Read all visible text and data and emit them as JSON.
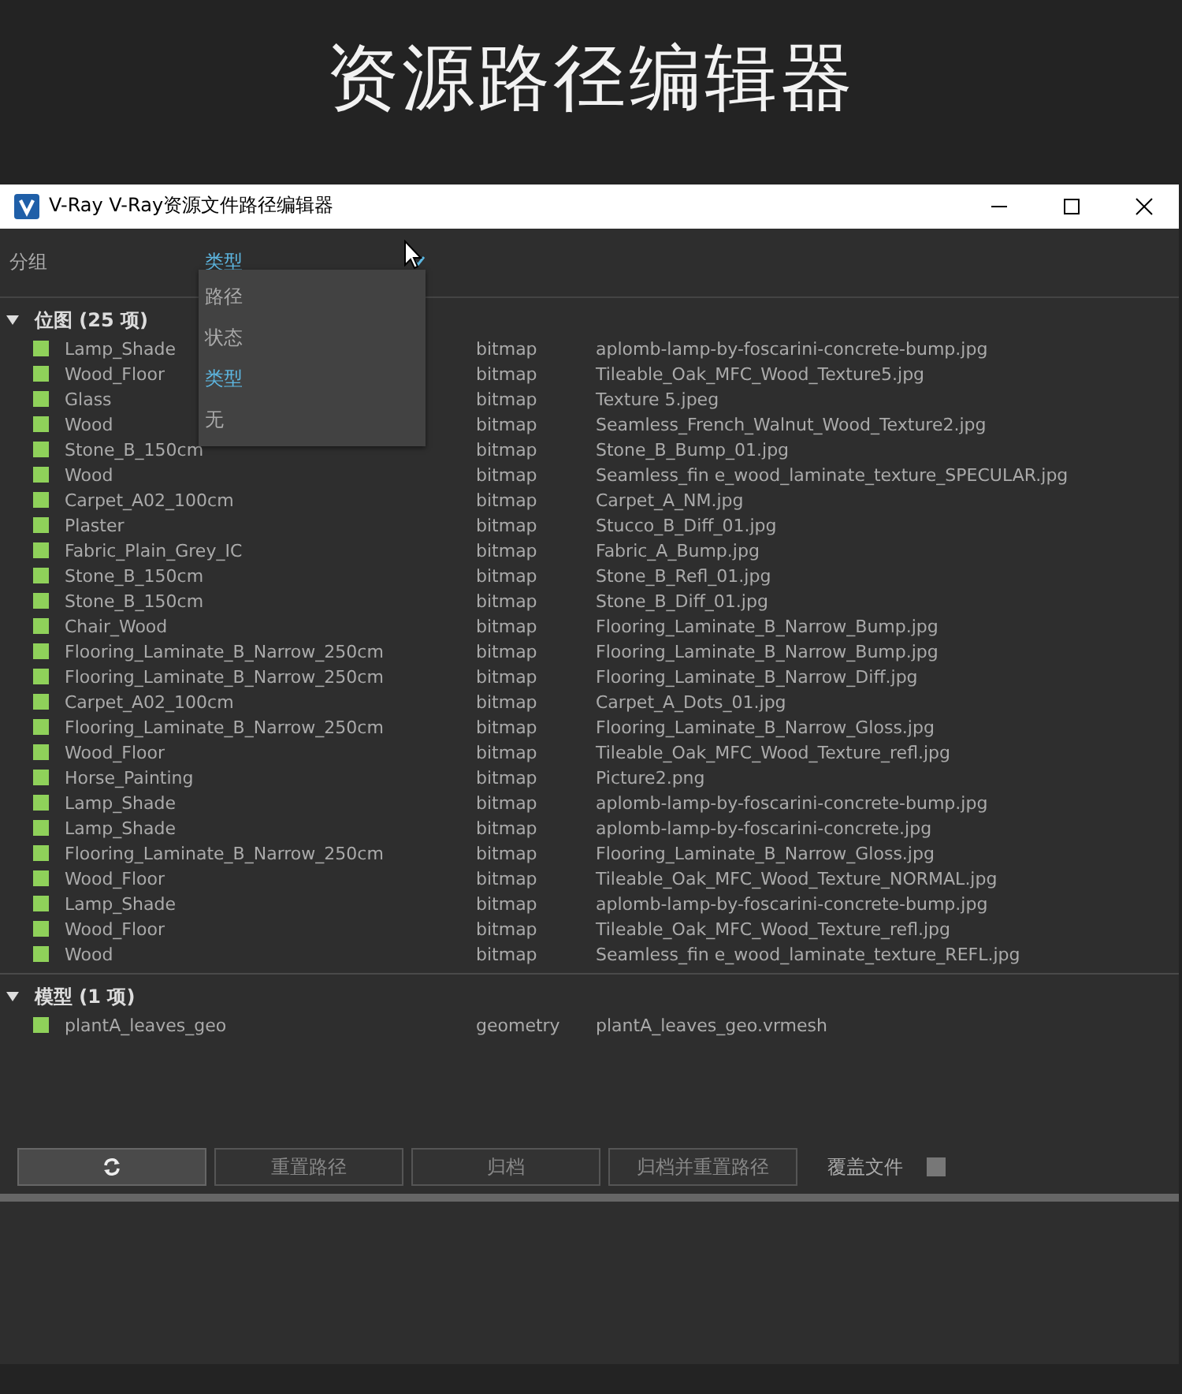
{
  "banner": {
    "title": "资源路径编辑器"
  },
  "window": {
    "title": "V-Ray V-Ray资源文件路径编辑器"
  },
  "group_by": {
    "label": "分组",
    "value": "类型",
    "expanded": true,
    "options": [
      {
        "label": "路径",
        "selected": false
      },
      {
        "label": "状态",
        "selected": false
      },
      {
        "label": "类型",
        "selected": true
      },
      {
        "label": "无",
        "selected": false
      }
    ]
  },
  "groups": [
    {
      "title": "位图 (25 项)",
      "expanded": true,
      "items": [
        {
          "name": "Lamp_Shade",
          "type": "bitmap",
          "path": "aplomb-lamp-by-foscarini-concrete-bump.jpg"
        },
        {
          "name": "Wood_Floor",
          "type": "bitmap",
          "path": "Tileable_Oak_MFC_Wood_Texture5.jpg"
        },
        {
          "name": "Glass",
          "type": "bitmap",
          "path": "Texture 5.jpeg"
        },
        {
          "name": "Wood",
          "type": "bitmap",
          "path": "Seamless_French_Walnut_Wood_Texture2.jpg"
        },
        {
          "name": "Stone_B_150cm",
          "type": "bitmap",
          "path": "Stone_B_Bump_01.jpg"
        },
        {
          "name": "Wood",
          "type": "bitmap",
          "path": "Seamless_fin e_wood_laminate_texture_SPECULAR.jpg"
        },
        {
          "name": "Carpet_A02_100cm",
          "type": "bitmap",
          "path": "Carpet_A_NM.jpg"
        },
        {
          "name": "Plaster",
          "type": "bitmap",
          "path": "Stucco_B_Diff_01.jpg"
        },
        {
          "name": "Fabric_Plain_Grey_IC",
          "type": "bitmap",
          "path": "Fabric_A_Bump.jpg"
        },
        {
          "name": "Stone_B_150cm",
          "type": "bitmap",
          "path": "Stone_B_Refl_01.jpg"
        },
        {
          "name": "Stone_B_150cm",
          "type": "bitmap",
          "path": "Stone_B_Diff_01.jpg"
        },
        {
          "name": "Chair_Wood",
          "type": "bitmap",
          "path": "Flooring_Laminate_B_Narrow_Bump.jpg"
        },
        {
          "name": "Flooring_Laminate_B_Narrow_250cm",
          "type": "bitmap",
          "path": "Flooring_Laminate_B_Narrow_Bump.jpg"
        },
        {
          "name": "Flooring_Laminate_B_Narrow_250cm",
          "type": "bitmap",
          "path": "Flooring_Laminate_B_Narrow_Diff.jpg"
        },
        {
          "name": "Carpet_A02_100cm",
          "type": "bitmap",
          "path": "Carpet_A_Dots_01.jpg"
        },
        {
          "name": "Flooring_Laminate_B_Narrow_250cm",
          "type": "bitmap",
          "path": "Flooring_Laminate_B_Narrow_Gloss.jpg"
        },
        {
          "name": "Wood_Floor",
          "type": "bitmap",
          "path": "Tileable_Oak_MFC_Wood_Texture_refl.jpg"
        },
        {
          "name": "Horse_Painting",
          "type": "bitmap",
          "path": "Picture2.png"
        },
        {
          "name": "Lamp_Shade",
          "type": "bitmap",
          "path": "aplomb-lamp-by-foscarini-concrete-bump.jpg"
        },
        {
          "name": "Lamp_Shade",
          "type": "bitmap",
          "path": "aplomb-lamp-by-foscarini-concrete.jpg"
        },
        {
          "name": "Flooring_Laminate_B_Narrow_250cm",
          "type": "bitmap",
          "path": "Flooring_Laminate_B_Narrow_Gloss.jpg"
        },
        {
          "name": "Wood_Floor",
          "type": "bitmap",
          "path": "Tileable_Oak_MFC_Wood_Texture_NORMAL.jpg"
        },
        {
          "name": "Lamp_Shade",
          "type": "bitmap",
          "path": "aplomb-lamp-by-foscarini-concrete-bump.jpg"
        },
        {
          "name": "Wood_Floor",
          "type": "bitmap",
          "path": "Tileable_Oak_MFC_Wood_Texture_refl.jpg"
        },
        {
          "name": "Wood",
          "type": "bitmap",
          "path": "Seamless_fin e_wood_laminate_texture_REFL.jpg"
        }
      ]
    },
    {
      "title": "模型 (1 项)",
      "expanded": true,
      "items": [
        {
          "name": "plantA_leaves_geo",
          "type": "geometry",
          "path": "plantA_leaves_geo.vrmesh"
        }
      ]
    }
  ],
  "buttons": [
    {
      "kind": "refresh"
    },
    {
      "kind": "text",
      "label": "重置路径",
      "disabled": true
    },
    {
      "kind": "text",
      "label": "归档",
      "disabled": true
    },
    {
      "kind": "text",
      "label": "归档并重置路径",
      "disabled": true
    }
  ],
  "overwrite": {
    "label": "覆盖文件",
    "checked": false
  }
}
